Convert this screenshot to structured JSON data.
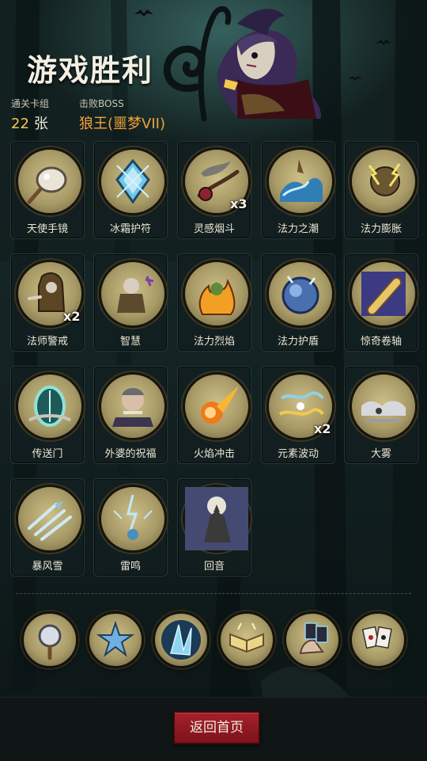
{
  "header": {
    "title": "游戏胜利",
    "deck_label": "通关卡组",
    "deck_count": "22",
    "deck_unit": "张",
    "boss_label": "击败BOSS",
    "boss_name": "狼王(噩梦VII)"
  },
  "cards": [
    {
      "name": "天使手镜",
      "icon": "hand-mirror-icon"
    },
    {
      "name": "冰霜护符",
      "icon": "frost-amulet-icon"
    },
    {
      "name": "灵感烟斗",
      "icon": "pipe-icon",
      "count": "x3"
    },
    {
      "name": "法力之潮",
      "icon": "mana-tide-icon"
    },
    {
      "name": "法力膨胀",
      "icon": "mana-surge-icon"
    },
    {
      "name": "法师警戒",
      "icon": "mage-vigilance-icon",
      "count": "x2"
    },
    {
      "name": "智慧",
      "icon": "wisdom-icon"
    },
    {
      "name": "法力烈焰",
      "icon": "mana-blaze-icon"
    },
    {
      "name": "法力护盾",
      "icon": "mana-shield-icon"
    },
    {
      "name": "惊奇卷轴",
      "icon": "scroll-icon"
    },
    {
      "name": "传送门",
      "icon": "portal-icon"
    },
    {
      "name": "外婆的祝福",
      "icon": "grandma-blessing-icon"
    },
    {
      "name": "火焰冲击",
      "icon": "fireball-icon"
    },
    {
      "name": "元素波动",
      "icon": "elemental-wave-icon",
      "count": "x2"
    },
    {
      "name": "大雾",
      "icon": "fog-icon"
    },
    {
      "name": "暴风雪",
      "icon": "blizzard-icon"
    },
    {
      "name": "雷鸣",
      "icon": "thunder-icon"
    },
    {
      "name": "回音",
      "icon": "werewolf-echo-icon"
    }
  ],
  "relics": [
    {
      "icon": "magic-mirror-relic-icon"
    },
    {
      "icon": "star-relic-icon"
    },
    {
      "icon": "ice-crystal-relic-icon"
    },
    {
      "icon": "spellbook-relic-icon"
    },
    {
      "icon": "card-hand-relic-icon"
    },
    {
      "icon": "playing-cards-relic-icon"
    }
  ],
  "buttons": {
    "home": "返回首页"
  },
  "colors": {
    "accent_gold": "#f2c94c",
    "boss_orange": "#f2a23c",
    "button_red": "#8f1a23",
    "coin_bg": "#a89a66"
  }
}
